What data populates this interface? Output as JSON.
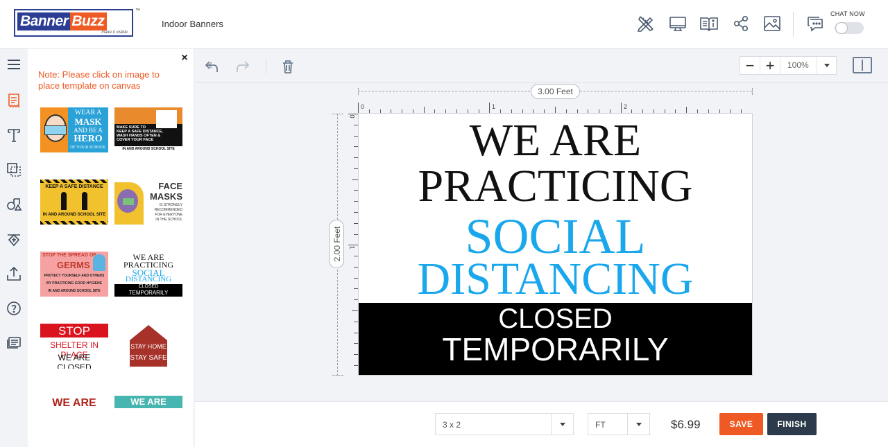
{
  "header": {
    "logo": {
      "word1": "Banner",
      "word2": "Buzz",
      "tagline": "make it visible",
      "tm": "™"
    },
    "page_title": "Indoor Banners",
    "chat_label": "CHAT NOW",
    "chat_toggle_on": false
  },
  "panel": {
    "close": "×",
    "note": "Note: Please click on image to place template on canvas",
    "templates": [
      {
        "lines": [
          "WEAR A",
          "MASK",
          "AND BE A",
          "HERO",
          "OF YOUR SCHOOL"
        ]
      },
      {
        "lines": [
          "MAKE SURE TO",
          "KEEP A SAFE DISTANCE,",
          "WASH HANDS OFTEN &",
          "COVER YOUR FACE",
          "IN AND AROUND SCHOOL SITE"
        ]
      },
      {
        "lines": [
          "KEEP A SAFE DISTANCE",
          "IN AND AROUND SCHOOL SITE"
        ]
      },
      {
        "lines": [
          "FACE",
          "MASKS",
          "IS STRONGLY",
          "RECOMMENDED",
          "FOR EVERYONE",
          "IN THE SCHOOL"
        ]
      },
      {
        "lines": [
          "STOP THE SPREAD OF",
          "GERMS",
          "PROTECT YOURSELF AND OTHERS",
          "BY PRACTICING GOOD HYGIENE",
          "IN AND AROUND SCHOOL SITE"
        ]
      },
      {
        "lines": [
          "WE ARE",
          "PRACTICING",
          "SOCIAL",
          "DISTANCING",
          "CLOSED",
          "TEMPORARILY"
        ]
      },
      {
        "lines": [
          "STOP",
          "SHELTER IN PLACE",
          "WE ARE CLOSED"
        ]
      },
      {
        "lines": [
          "STAY HOME",
          "STAY SAFE"
        ]
      },
      {
        "lines": [
          "WE ARE"
        ]
      },
      {
        "lines": [
          "WE ARE"
        ]
      }
    ]
  },
  "toolbar": {
    "zoom": "100%"
  },
  "canvas": {
    "width_label": "3.00 Feet",
    "height_label": "2.00 Feet",
    "ruler_x": [
      "0",
      "1",
      "2"
    ],
    "ruler_y": [
      "0",
      "1"
    ],
    "lines": [
      "WE ARE",
      "PRACTICING",
      "SOCIAL",
      "DISTANCING",
      "CLOSED",
      "TEMPORARILY"
    ]
  },
  "footer": {
    "size": "3 x 2",
    "unit": "FT",
    "price": "$6.99",
    "save": "SAVE",
    "finish": "FINISH"
  },
  "colors": {
    "accent": "#ef5a24",
    "brand": "#2b3e93",
    "dark": "#2d3a4b",
    "social_blue": "#1aa7ec"
  }
}
